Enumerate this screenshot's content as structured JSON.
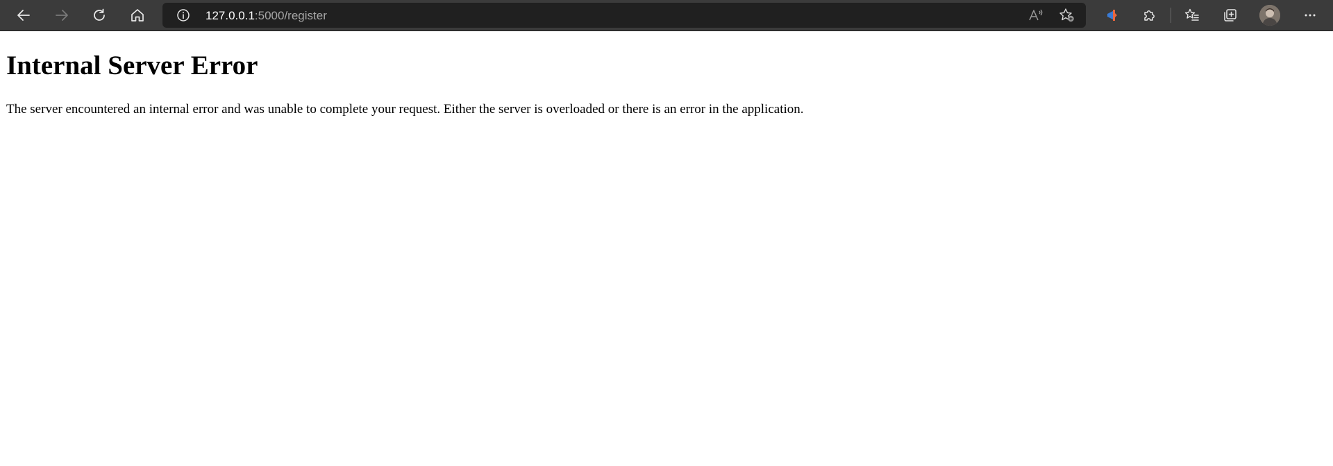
{
  "browser": {
    "nav": {
      "back_icon": "arrow-left-icon",
      "forward_icon": "arrow-right-icon",
      "refresh_icon": "refresh-icon",
      "home_icon": "home-icon"
    },
    "address_bar": {
      "host": "127.0.0.1",
      "path": ":5000/register",
      "site_info_icon": "info-icon"
    },
    "actions": {
      "read_aloud_icon": "read-aloud-icon",
      "add_favorite_icon": "star-add-icon",
      "extension_icon": "extension-pin-icon",
      "extensions_icon": "puzzle-icon",
      "favorites_icon": "favorites-list-icon",
      "collections_icon": "collections-icon",
      "profile_icon": "avatar",
      "menu_icon": "more-icon"
    },
    "colors": {
      "toolbar_bg": "#3b3b3b",
      "address_bg": "#202020",
      "url_host": "#ffffff",
      "url_path": "#a6a6a6",
      "extension_accent": "#e8663d"
    }
  },
  "page": {
    "heading": "Internal Server Error",
    "message": "The server encountered an internal error and was unable to complete your request. Either the server is overloaded or there is an error in the application."
  }
}
